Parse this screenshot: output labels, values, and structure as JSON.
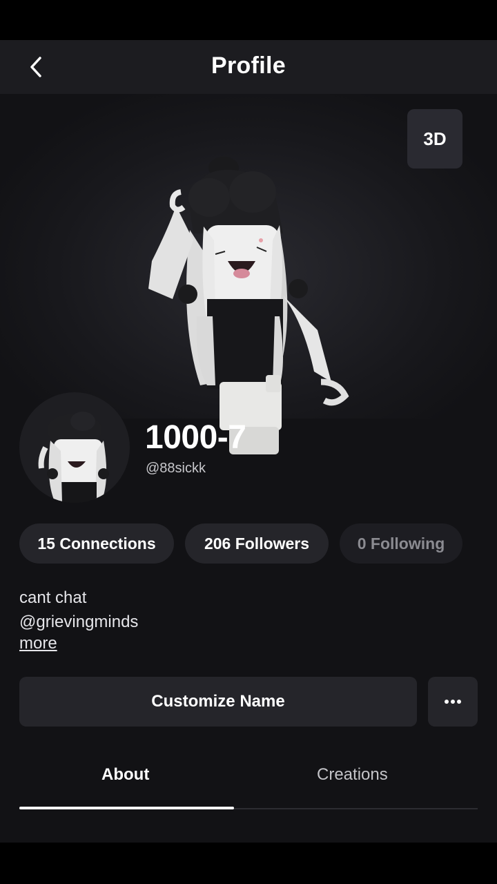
{
  "header": {
    "title": "Profile",
    "back_icon": "chevron-left-icon"
  },
  "hero": {
    "view_toggle_label": "3D"
  },
  "profile": {
    "display_name": "1000-7",
    "username": "@88sickk"
  },
  "stats": [
    {
      "label": "15 Connections"
    },
    {
      "label": "206 Followers"
    },
    {
      "label": "0 Following"
    }
  ],
  "bio": {
    "line1": "cant chat",
    "line2": "@grievingminds",
    "more_label": "more"
  },
  "actions": {
    "customize_label": "Customize Name",
    "more_icon": "ellipsis-icon"
  },
  "tabs": [
    {
      "label": "About",
      "active": true
    },
    {
      "label": "Creations",
      "active": false
    }
  ],
  "colors": {
    "background": "#121215",
    "header": "#1c1c20",
    "chip": "#25252a",
    "text": "#ffffff"
  }
}
